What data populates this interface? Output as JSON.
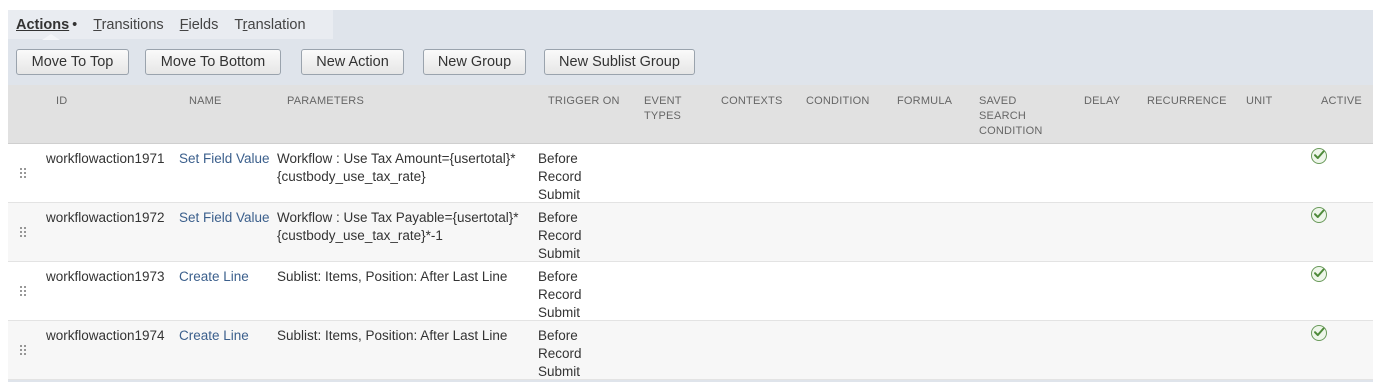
{
  "tabs": [
    {
      "label": "Actions",
      "marker": "•"
    },
    {
      "label_u": "T",
      "label_rest": "ransitions"
    },
    {
      "label_u": "F",
      "label_rest": "ields"
    },
    {
      "label_pre": "T",
      "label_u": "r",
      "label_rest": "anslation"
    }
  ],
  "toolbar": {
    "move_top": "Move To Top",
    "move_bottom": "Move To Bottom",
    "new_action": "New Action",
    "new_group": "New Group",
    "new_sublist_group": "New Sublist Group"
  },
  "columns": {
    "id": "ID",
    "name": "NAME",
    "parameters": "PARAMETERS",
    "trigger_on": "TRIGGER ON",
    "event_types_1": "EVENT",
    "event_types_2": "TYPES",
    "contexts": "CONTEXTS",
    "condition": "CONDITION",
    "formula": "FORMULA",
    "saved_search_1": "SAVED",
    "saved_search_2": "SEARCH",
    "saved_search_3": "CONDITION",
    "delay": "DELAY",
    "recurrence": "RECURRENCE",
    "unit": "UNIT",
    "active": "ACTIVE"
  },
  "rows": [
    {
      "id": "workflowaction1971",
      "name": "Set Field Value",
      "param_1": "Workflow : Use Tax Amount={usertotal}*",
      "param_2": "{custbody_use_tax_rate}",
      "trigger_1": "Before",
      "trigger_2": "Record",
      "trigger_3": "Submit",
      "active": true
    },
    {
      "id": "workflowaction1972",
      "name": "Set Field Value",
      "param_1": "Workflow : Use Tax Payable={usertotal}*",
      "param_2": "{custbody_use_tax_rate}*-1",
      "trigger_1": "Before",
      "trigger_2": "Record",
      "trigger_3": "Submit",
      "active": true
    },
    {
      "id": "workflowaction1973",
      "name": "Create Line",
      "param_1": "Sublist: Items, Position: After Last Line",
      "param_2": "",
      "trigger_1": "Before",
      "trigger_2": "Record",
      "trigger_3": "Submit",
      "active": true
    },
    {
      "id": "workflowaction1974",
      "name": "Create Line",
      "param_1": "Sublist: Items, Position: After Last Line",
      "param_2": "",
      "trigger_1": "Before",
      "trigger_2": "Record",
      "trigger_3": "Submit",
      "active": true
    }
  ],
  "colors": {
    "link": "#3b5f8c",
    "panel": "#dfe4eb",
    "header": "#e1e1e1",
    "check": "#4e8a3a"
  }
}
